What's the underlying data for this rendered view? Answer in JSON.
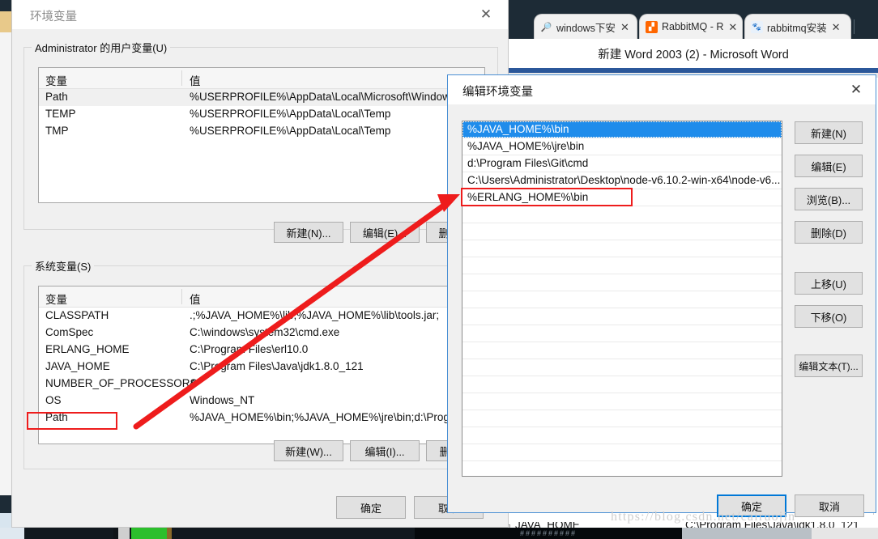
{
  "desktop": {
    "word_window": {
      "title": "新建 Word 2003 (2) - Microsoft Word",
      "tabs": [
        {
          "label": "windows下安",
          "favicon": "search-icon",
          "close": "✕"
        },
        {
          "label": "RabbitMQ - R",
          "favicon": "rabbitmq-icon",
          "close": "✕"
        },
        {
          "label": "rabbitmq安装",
          "favicon": "baidu-icon",
          "close": "✕"
        }
      ]
    },
    "bottom_peek_row": {
      "name": "JAVA_HOME",
      "value": "C:\\Program Files\\Java\\jdk1.8.0_121"
    }
  },
  "env_dialog": {
    "title": "环境变量",
    "close_label": "✕",
    "user_group": {
      "legend": "Administrator 的用户变量(U)",
      "columns": [
        "变量",
        "值"
      ],
      "rows": [
        {
          "name": "Path",
          "value": "%USERPROFILE%\\AppData\\Local\\Microsoft\\WindowsApps;",
          "selected": true
        },
        {
          "name": "TEMP",
          "value": "%USERPROFILE%\\AppData\\Local\\Temp",
          "selected": false
        },
        {
          "name": "TMP",
          "value": "%USERPROFILE%\\AppData\\Local\\Temp",
          "selected": false
        }
      ],
      "buttons": {
        "new": "新建(N)...",
        "edit": "编辑(E)...",
        "delete": "删除(D)..."
      }
    },
    "system_group": {
      "legend": "系统变量(S)",
      "columns": [
        "变量",
        "值"
      ],
      "rows": [
        {
          "name": "CLASSPATH",
          "value": ".;%JAVA_HOME%\\lib;%JAVA_HOME%\\lib\\tools.jar;",
          "highlight": false
        },
        {
          "name": "ComSpec",
          "value": "C:\\windows\\system32\\cmd.exe",
          "highlight": false
        },
        {
          "name": "ERLANG_HOME",
          "value": "C:\\Program Files\\erl10.0",
          "highlight": false
        },
        {
          "name": "JAVA_HOME",
          "value": "C:\\Program Files\\Java\\jdk1.8.0_121",
          "highlight": false
        },
        {
          "name": "NUMBER_OF_PROCESSORS",
          "value": "4",
          "highlight": false
        },
        {
          "name": "OS",
          "value": "Windows_NT",
          "highlight": false
        },
        {
          "name": "Path",
          "value": "%JAVA_HOME%\\bin;%JAVA_HOME%\\jre\\bin;d:\\Program Fil",
          "highlight": true
        }
      ],
      "buttons": {
        "new": "新建(W)...",
        "edit": "编辑(I)...",
        "delete": "删除(L)..."
      }
    },
    "footer": {
      "ok": "确定",
      "cancel": "取消"
    }
  },
  "edit_dialog": {
    "title": "编辑环境变量",
    "close_label": "✕",
    "entries": [
      {
        "text": "%JAVA_HOME%\\bin",
        "selected": true,
        "highlight": false
      },
      {
        "text": "%JAVA_HOME%\\jre\\bin",
        "selected": false,
        "highlight": false
      },
      {
        "text": "d:\\Program Files\\Git\\cmd",
        "selected": false,
        "highlight": false
      },
      {
        "text": "C:\\Users\\Administrator\\Desktop\\node-v6.10.2-win-x64\\node-v6...",
        "selected": false,
        "highlight": false
      },
      {
        "text": "%ERLANG_HOME%\\bin",
        "selected": false,
        "highlight": true
      }
    ],
    "side_buttons": [
      {
        "label": "新建(N)"
      },
      {
        "label": "编辑(E)"
      },
      {
        "label": "浏览(B)..."
      },
      {
        "label": "删除(D)"
      },
      {
        "label": "上移(U)"
      },
      {
        "label": "下移(O)"
      },
      {
        "label": "编辑文本(T)..."
      }
    ],
    "footer": {
      "ok": "确定",
      "cancel": "取消"
    }
  },
  "annotation": {
    "watermark": "https://blog.csdn.net/cairuojin",
    "arrow_color": "#ee1c1c"
  }
}
